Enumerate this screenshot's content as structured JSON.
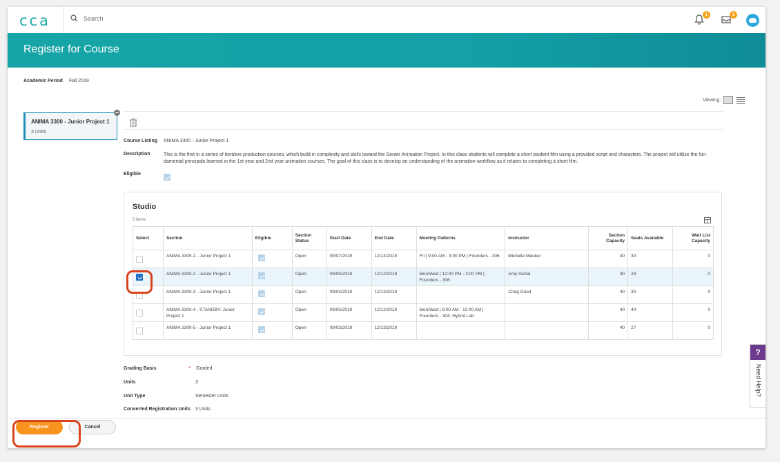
{
  "app": {
    "logo": "cca",
    "search_placeholder": "Search",
    "notif_count": "1",
    "inbox_count": "1"
  },
  "header": {
    "title": "Register for Course"
  },
  "academic_period": {
    "label": "Academic Period",
    "value": "Fall 2019"
  },
  "viewing": {
    "label": "Viewing:"
  },
  "course_card": {
    "title": "ANIMA 3300 - Junior Project 1",
    "units": "3 Units"
  },
  "details": {
    "course_listing_label": "Course Listing",
    "course_listing_value": "ANIMA 3300 - Junior Project 1",
    "description_label": "Description",
    "description_value": "This is the first in a series of iterative production courses, which build in complexity and skills toward the Senior Animation Project. In this class students will complete a short student film using a provided script and characters. The project will utilize the fun-damental principals learned in the 1st year and 2nd year animation courses. The goal of this class is to develop an understanding of the animation workflow as it relates to completing a short film.",
    "eligible_label": "Eligible"
  },
  "studio": {
    "title": "Studio",
    "count": "5 items",
    "columns": [
      "Select",
      "Section",
      "Eligible",
      "Section Status",
      "Start Date",
      "End Date",
      "Meeting Patterns",
      "Instructor",
      "Section Capacity",
      "Seats Available",
      "Wait List Capacity"
    ],
    "rows": [
      {
        "section": "ANIMA 3300-1 - Junior Project 1",
        "status": "Open",
        "start": "09/07/2019",
        "end": "12/14/2019",
        "meeting": "Fri | 9:00 AM - 3:00 PM | Founders - 306",
        "instructor": "Michelle Meeker",
        "capacity": "40",
        "seats": "30",
        "waitlist": "0",
        "selected": false
      },
      {
        "section": "ANIMA 3300-2 - Junior Project 1",
        "status": "Open",
        "start": "09/05/2019",
        "end": "12/12/2019",
        "meeting": "Mon/Wed | 12:00 PM - 3:00 PM | Founders - 306",
        "instructor": "Amy Gohal",
        "capacity": "40",
        "seats": "29",
        "waitlist": "0",
        "selected": true
      },
      {
        "section": "ANIMA 3300-3 - Junior Project 1",
        "status": "Open",
        "start": "09/04/2019",
        "end": "12/13/2019",
        "meeting": "",
        "instructor": "Craig Good",
        "capacity": "40",
        "seats": "30",
        "waitlist": "0",
        "selected": false
      },
      {
        "section": "ANIMA 3300-4 - STANDBY: Junior Project 1",
        "status": "Open",
        "start": "09/05/2019",
        "end": "12/12/2019",
        "meeting": "Mon/Wed | 8:00 AM - 11:00 AM | Founders - 304: Hybrid Lab",
        "instructor": "",
        "capacity": "40",
        "seats": "40",
        "waitlist": "0",
        "selected": false
      },
      {
        "section": "ANIMA 3300-5 - Junior Project 1",
        "status": "Open",
        "start": "09/03/2019",
        "end": "12/13/2019",
        "meeting": "",
        "instructor": "",
        "capacity": "40",
        "seats": "27",
        "waitlist": "0",
        "selected": false
      }
    ]
  },
  "summary": {
    "grading_basis_label": "Grading Basis",
    "grading_basis_value": "Graded",
    "units_label": "Units",
    "units_value": "3",
    "unit_type_label": "Unit Type",
    "unit_type_value": "Semester Units",
    "converted_label": "Converted Registration Units",
    "converted_value": "3 Units"
  },
  "buttons": {
    "register": "Register",
    "cancel": "Cancel"
  },
  "help": {
    "icon": "?",
    "label": "Need Help?"
  },
  "colors": {
    "teal": "#16a5a7",
    "orange": "#f7941d",
    "highlight": "#d9421a",
    "help_purple": "#6c3b8f"
  }
}
